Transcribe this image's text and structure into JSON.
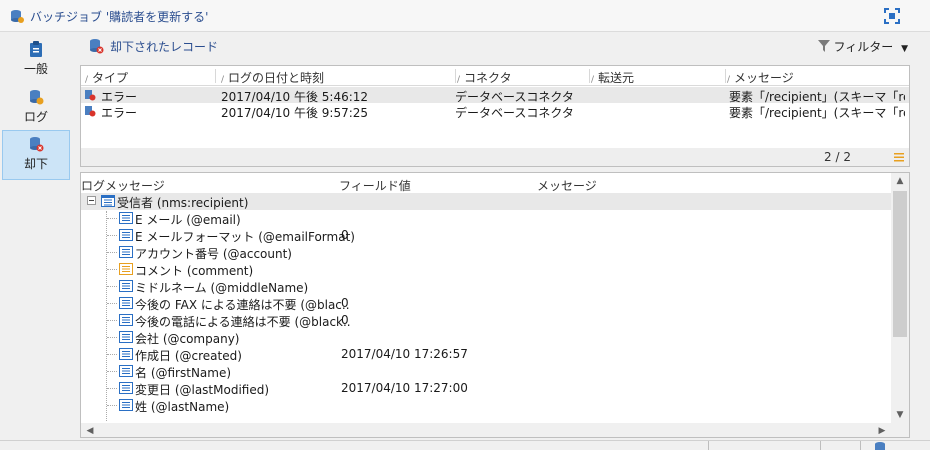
{
  "window": {
    "title": "バッチジョブ '購読者を更新する'"
  },
  "sidebar": {
    "items": [
      {
        "label": "一般",
        "icon": "clipboard-icon",
        "active": false
      },
      {
        "label": "ログ",
        "icon": "log-warning-icon",
        "active": false
      },
      {
        "label": "却下",
        "icon": "rejected-icon",
        "active": true
      }
    ]
  },
  "toolbar": {
    "rejected_records_label": "却下されたレコード",
    "filter_label": "フィルター"
  },
  "grid": {
    "columns": [
      "タイプ",
      "ログの日付と時刻",
      "コネクタ",
      "転送元",
      "メッセージ"
    ],
    "rows": [
      {
        "type": "エラー",
        "datetime": "2017/04/10 午後 5:46:12",
        "connector": "データベースコネクタ",
        "source": "",
        "message": "要素「/recipient」(スキーマ「rec..."
      },
      {
        "type": "エラー",
        "datetime": "2017/04/10 午後 9:57:25",
        "connector": "データベースコネクタ",
        "source": "",
        "message": "要素「/recipient」(スキーマ「rec..."
      }
    ],
    "pager": "2 / 2"
  },
  "tree": {
    "columns": [
      "ログメッセージ",
      "フィールド値",
      "メッセージ"
    ],
    "root": "受信者 (nms:recipient)",
    "nodes": [
      {
        "label": "E メール (@email)",
        "value": ""
      },
      {
        "label": "E メールフォーマット (@emailFormat)",
        "value": "0"
      },
      {
        "label": "アカウント番号 (@account)",
        "value": ""
      },
      {
        "label": "コメント (comment)",
        "value": ""
      },
      {
        "label": "ミドルネーム (@middleName)",
        "value": ""
      },
      {
        "label": "今後の FAX による連絡は不要 (@blac..",
        "value": "0"
      },
      {
        "label": "今後の電話による連絡は不要 (@black..",
        "value": "0"
      },
      {
        "label": "会社 (@company)",
        "value": ""
      },
      {
        "label": "作成日 (@created)",
        "value": "2017/04/10 17:26:57"
      },
      {
        "label": "名 (@firstName)",
        "value": ""
      },
      {
        "label": "変更日 (@lastModified)",
        "value": "2017/04/10 17:27:00"
      },
      {
        "label": "姓 (@lastName)",
        "value": ""
      }
    ]
  },
  "colors": {
    "accent": "#2a4d8f",
    "selected": "#cce4f7",
    "error": "#d9342b"
  }
}
